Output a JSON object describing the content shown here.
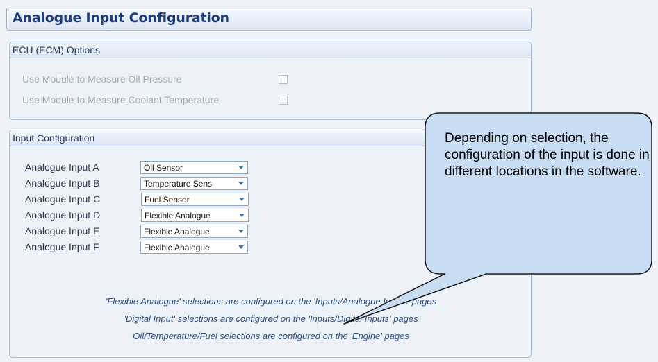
{
  "title": "Analogue Input Configuration",
  "ecu": {
    "header": "ECU (ECM) Options",
    "options": [
      {
        "label": "Use Module to Measure Oil Pressure"
      },
      {
        "label": "Use Module to Measure Coolant Temperature"
      }
    ]
  },
  "inputs": {
    "header": "Input Configuration",
    "rows": [
      {
        "label": "Analogue Input A",
        "value": "Oil Sensor"
      },
      {
        "label": "Analogue Input B",
        "value": "Temperature Sens"
      },
      {
        "label": "Analogue Input C",
        "value": "Fuel Sensor"
      },
      {
        "label": "Analogue Input D",
        "value": "Flexible Analogue"
      },
      {
        "label": "Analogue Input E",
        "value": "Flexible Analogue"
      },
      {
        "label": "Analogue Input F",
        "value": "Flexible Analogue"
      }
    ],
    "notes": [
      "'Flexible Analogue' selections are configured on the 'Inputs/Analogue Inputs' pages",
      "'Digital Input' selections are configured on the 'Inputs/Digital Inputs' pages",
      "Oil/Temperature/Fuel selections are configured on the 'Engine' pages"
    ]
  },
  "callout": {
    "text": "Depending on selection, the configuration of the input is done in different locations in the software."
  },
  "colors": {
    "title": "#1f3d7a",
    "callout_fill": "#c9ddf2",
    "note_text": "#2d4f80"
  }
}
